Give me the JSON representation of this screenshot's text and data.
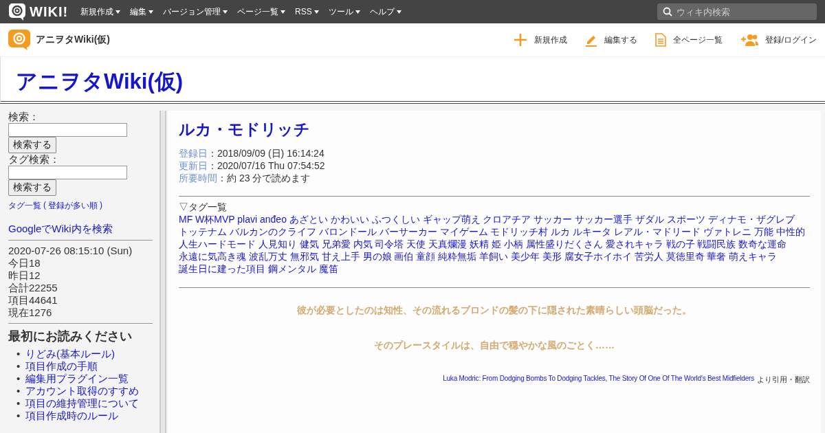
{
  "topbar": {
    "logo": "WIKI!",
    "menu": [
      {
        "label": "新規作成"
      },
      {
        "label": "編集"
      },
      {
        "label": "バージョン管理"
      },
      {
        "label": "ページ一覧"
      },
      {
        "label": "RSS"
      },
      {
        "label": "ツール"
      },
      {
        "label": "ヘルプ"
      }
    ],
    "search": {
      "placeholder": "ウィキ内検索"
    }
  },
  "header": {
    "site_name": "アニヲタWiki(仮)",
    "actions": [
      {
        "kind": "plus",
        "label": "新規作成"
      },
      {
        "kind": "pencil",
        "label": "編集する"
      },
      {
        "kind": "page",
        "label": "全ページ一覧"
      },
      {
        "kind": "user",
        "label": "登録/ログイン"
      }
    ]
  },
  "site_title": "アニヲタWiki(仮)",
  "sidebar": {
    "search_label": "検索：",
    "search_button": "検索する",
    "tag_search_label": "タグ検索：",
    "tag_search_button": "検索する",
    "tag_list_link": "タグ一覧",
    "tag_paren_open": "(",
    "tag_popular_link": "登録が多い順",
    "tag_paren_close": ")",
    "google_link": "GoogleでWiki内を検索",
    "stats": [
      "2020-07-26 08:15:10 (Sun)",
      "今日18",
      "昨日12",
      "合計22255",
      "項目44641",
      "現在1276"
    ],
    "read_first_heading": "最初にお読みください",
    "read_first_links": [
      {
        "marker": "•",
        "label": "りどみ(基本ルール)"
      },
      {
        "marker": "•",
        "label": "項目作成の手順"
      },
      {
        "marker": "•",
        "label": "編集用プラグイン一覧"
      },
      {
        "marker": "•",
        "label": "アカウント取得のすすめ"
      },
      {
        "marker": "•",
        "label": "項目の維持管理について"
      },
      {
        "marker": "•",
        "label": "項目作成時のルール"
      }
    ]
  },
  "article": {
    "title": "ルカ・モドリッチ",
    "meta": [
      {
        "label": "登録日",
        "value": "：2018/09/09 (日) 16:14:24"
      },
      {
        "label": "更新日",
        "value": "：2020/07/16 Thu 07:54:52"
      },
      {
        "label": "所要時間",
        "value": "：約 23 分で読めます"
      }
    ],
    "tags_heading": "▽タグ一覧",
    "tags": [
      "MF",
      "W杯MVP",
      "plavi anđeo",
      "あざとい",
      "かわいい",
      "ふつくしい",
      "ギャップ萌え",
      "クロアチア",
      "サッカー",
      "サッカー選手",
      "ザダル",
      "スポーツ",
      "ディナモ・ザグレブ",
      "トッテナム",
      "バルカンのクライフ",
      "バロンドール",
      "バーサーカー",
      "マイゲーム",
      "モドリッチ村",
      "ルカ",
      "ルキータ",
      "レアル・マドリード",
      "ヴァトレニ",
      "万能",
      "中性的",
      "人生ハードモード",
      "人見知り",
      "健気",
      "兄弟愛",
      "内気",
      "司令塔",
      "天使",
      "天真爛漫",
      "妖精",
      "姫",
      "小柄",
      "属性盛りだくさん",
      "愛されキャラ",
      "戦の子",
      "戦闘民族",
      "数奇な運命",
      "永遠に気高き魂",
      "波乱万丈",
      "無邪気",
      "甘え上手",
      "男の娘",
      "画伯",
      "童顔",
      "純粋無垢",
      "羊飼い",
      "美少年",
      "美形",
      "腐女子ホイホイ",
      "苦労人",
      "莫徳里奇",
      "華奢",
      "萌えキャラ",
      "誕生日に建った項目",
      "鋼メンタル",
      "魔笛"
    ],
    "quotes": [
      "彼が必要としたのは知性、その流れるブロンドの髪の下に隠された素晴らしい頭脳だった。",
      "そのプレースタイルは、自由で穏やかな風のごとく……"
    ],
    "citation": {
      "link": "Luka Modric: From Dodging Bombs To Dodging Tackles, The Story Of One Of The World's Best Midfielders",
      "suffix": "より引用・翻訳"
    }
  }
}
